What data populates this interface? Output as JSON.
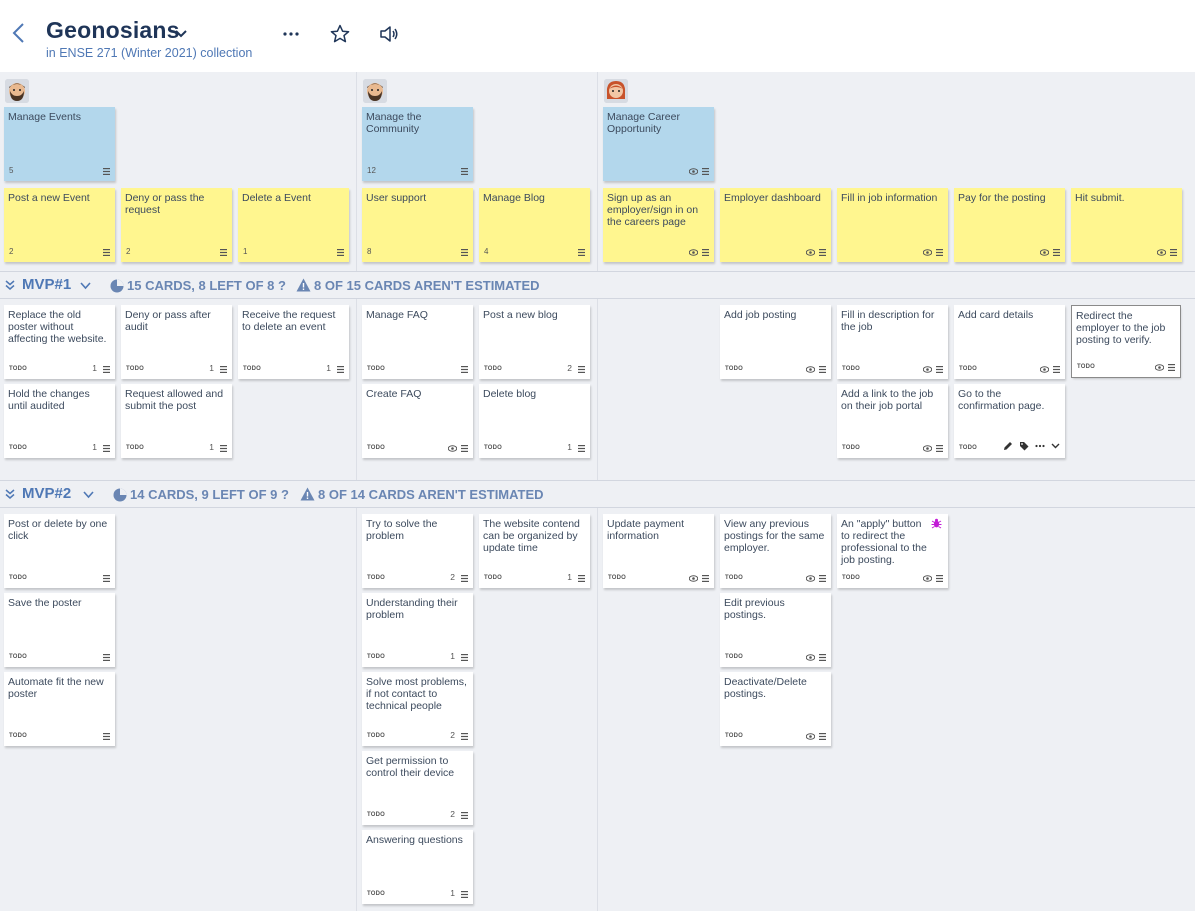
{
  "header": {
    "title": "Geonosians",
    "subtitle": "in ENSE 271 (Winter 2021) collection",
    "icons": [
      "back-icon",
      "chevron-down-icon",
      "more-icon",
      "star-icon",
      "speaker-icon"
    ]
  },
  "colors": {
    "blue_card": "#b3d7ec",
    "yellow_card": "#fff68f",
    "accent": "#4f78b5",
    "title": "#1f3558"
  },
  "epics": [
    {
      "label": "Manage Events",
      "count": "5"
    },
    {
      "label": "Manage the Community",
      "count": "12"
    },
    {
      "label": "Manage Career Opportunity",
      "count": ""
    }
  ],
  "activities": [
    {
      "label": "Post a new Event",
      "num": "2"
    },
    {
      "label": "Deny or pass the request",
      "num": "2"
    },
    {
      "label": "Delete a Event",
      "num": "1"
    },
    {
      "label": "User support",
      "num": "8"
    },
    {
      "label": "Manage Blog",
      "num": "4"
    },
    {
      "label": "Sign up as an employer/sign in on the careers page",
      "num": ""
    },
    {
      "label": "Employer dashboard",
      "num": ""
    },
    {
      "label": "Fill in job information",
      "num": ""
    },
    {
      "label": "Pay for the posting",
      "num": ""
    },
    {
      "label": "Hit submit.",
      "num": ""
    }
  ],
  "releases": [
    {
      "title": "MVP#1",
      "cards_stat": "15 cards, 8 left of 8 ?",
      "estimate_stat": "8 of 15 cards aren't estimated"
    },
    {
      "title": "MVP#2",
      "cards_stat": "14 cards, 9 left of 9 ?",
      "estimate_stat": "8 of 14 cards aren't estimated"
    }
  ],
  "status_label": "TODO",
  "mvp1_cards": [
    {
      "text": "Replace the old poster without affecting the website.",
      "est": "1"
    },
    {
      "text": "Deny or pass after audit",
      "est": "1"
    },
    {
      "text": "Receive the request to delete an event",
      "est": "1"
    },
    {
      "text": "Manage FAQ",
      "est": ""
    },
    {
      "text": "Post a new blog",
      "est": "2"
    },
    {
      "text": "Add job posting",
      "est": ""
    },
    {
      "text": "Fill in description for the job",
      "est": ""
    },
    {
      "text": "Add card details",
      "est": ""
    },
    {
      "text": "Redirect the employer to the job posting to verify.",
      "est": ""
    },
    {
      "text": "Hold the changes until audited",
      "est": "1"
    },
    {
      "text": "Request allowed and submit the post",
      "est": "1"
    },
    {
      "text": "Create FAQ",
      "est": ""
    },
    {
      "text": "Delete blog",
      "est": "1"
    },
    {
      "text": "Add a link to the job on their job portal",
      "est": ""
    },
    {
      "text": "Go to the confirmation page.",
      "est": ""
    }
  ],
  "mvp2_cards": [
    {
      "text": "Post or delete by one click",
      "est": ""
    },
    {
      "text": "Try to solve the problem",
      "est": "2"
    },
    {
      "text": "The website contend can be organized by update time",
      "est": "1"
    },
    {
      "text": "Update payment information",
      "est": ""
    },
    {
      "text": "View any previous postings for the same employer.",
      "est": ""
    },
    {
      "text": "An \"apply\" button to redirect the professional to the job posting.",
      "est": ""
    },
    {
      "text": "Save the poster",
      "est": ""
    },
    {
      "text": "Understanding their problem",
      "est": "1"
    },
    {
      "text": "Edit previous postings.",
      "est": ""
    },
    {
      "text": "Automate fit the new poster",
      "est": ""
    },
    {
      "text": "Solve most problems, if not contact to technical people",
      "est": "2"
    },
    {
      "text": "Deactivate/Delete postings.",
      "est": ""
    },
    {
      "text": "Get permission to control their device",
      "est": "2"
    },
    {
      "text": "Answering questions",
      "est": "1"
    }
  ]
}
